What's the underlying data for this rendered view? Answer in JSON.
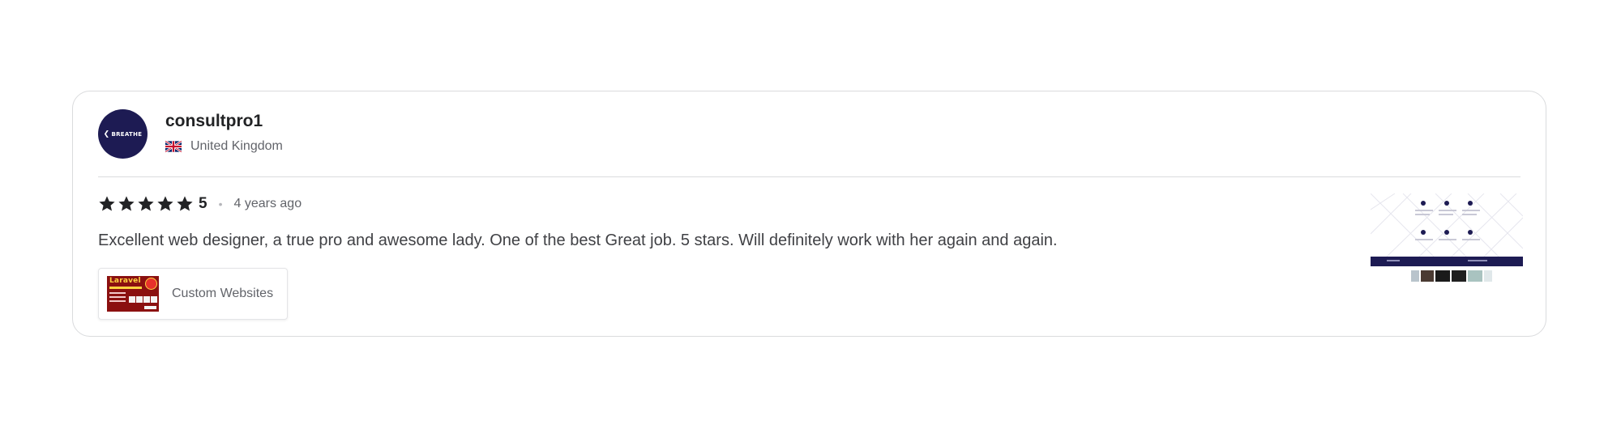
{
  "review": {
    "avatar": {
      "text": "BREATHE",
      "color": "#1d1b53"
    },
    "username": "consultpro1",
    "country": "United Kingdom",
    "flag_icon": "uk-flag-icon",
    "rating": {
      "stars": 5,
      "max_stars": 5,
      "value_label": "5",
      "star_color": "#222325"
    },
    "separator": "•",
    "time_ago": "4 years ago",
    "text": "Excellent web designer, a true pro and awesome lady. One of the best Great job. 5 stars. Will definitely work with her again and again.",
    "gig": {
      "label": "Custom Websites",
      "thumbnail_text": "Laravel"
    },
    "attachment": {
      "icon": "image-thumbnail",
      "theme_color": "#1d1b53"
    }
  }
}
